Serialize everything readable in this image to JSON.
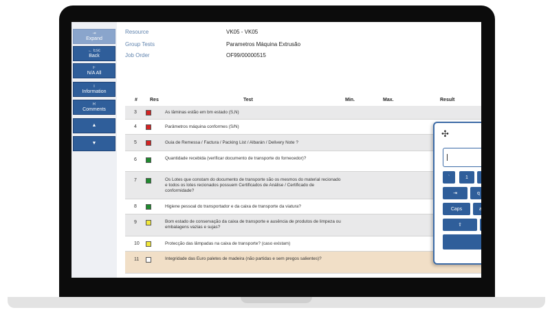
{
  "sidebar": {
    "expand": {
      "icon": "⇥",
      "label": "Expand"
    },
    "back": {
      "icon": "← Esc",
      "label": "Back"
    },
    "na_all": {
      "icon": "F",
      "label": "N/A All"
    },
    "information": {
      "icon": "I",
      "label": "Information"
    },
    "comments": {
      "icon": "R",
      "label": "Comments"
    },
    "up": {
      "icon": "▲"
    },
    "down": {
      "icon": "▼"
    }
  },
  "header": {
    "resource_label": "Resource",
    "resource_value": "VK05 - VK05",
    "group_tests_label": "Group Tests",
    "group_tests_value": "Parametros Máquina Extrusão",
    "job_order_label": "Job Order",
    "job_order_value": "OF99/00000515"
  },
  "table": {
    "columns": {
      "num": "#",
      "res": "Res",
      "test": "Test",
      "min": "Min.",
      "max": "Max.",
      "result": "Result"
    },
    "rows": [
      {
        "num": "3",
        "status": "red",
        "color": "#d42323",
        "text": "As lâminas estão em bm estado (S,N)"
      },
      {
        "num": "4",
        "status": "red",
        "color": "#d42323",
        "text": "Parâmetros máquina conformes (S/N)"
      },
      {
        "num": "5",
        "status": "red",
        "color": "#d42323",
        "text": "Guia de Remessa / Factura / Packing List / Albarán / Delivery Note ?"
      },
      {
        "num": "6",
        "status": "green",
        "color": "#1f8a2e",
        "text": "Quantidade recebida (verificar documento de transporte do fornecedor)?"
      },
      {
        "num": "7",
        "status": "green",
        "color": "#1f8a2e",
        "text": "Os Lotes que constam do documento de transporte são os mesmos do material recionado e todos os lotes recionados possuem Certificados de Análise / Certificado de conformidade?"
      },
      {
        "num": "8",
        "status": "green",
        "color": "#1f8a2e",
        "text": "Higiene pessoal do transportador e da caixa de transporte da viatura?"
      },
      {
        "num": "9",
        "status": "yellow",
        "color": "#f2e83a",
        "text": "Bom estado de conservação da caixa de transporte e ausência de produtos de limpeza ou embalagens vazias e sujas?"
      },
      {
        "num": "10",
        "status": "yellow",
        "color": "#f2e83a",
        "text": "Protecção das lâmpadas na caixa de transporte? (caso existam)"
      },
      {
        "num": "11",
        "status": "empty",
        "color": "#ffffff",
        "text": "Integridade das Euro paletes de madeira (não partidas e sem pregos salientes)?"
      }
    ]
  },
  "keyboard": {
    "move_icon": "✣",
    "keys": {
      "backtick": "`",
      "one": "1",
      "tab": "⇥",
      "q": "q",
      "caps": "Caps",
      "a": "a",
      "shift": "⇧"
    }
  }
}
